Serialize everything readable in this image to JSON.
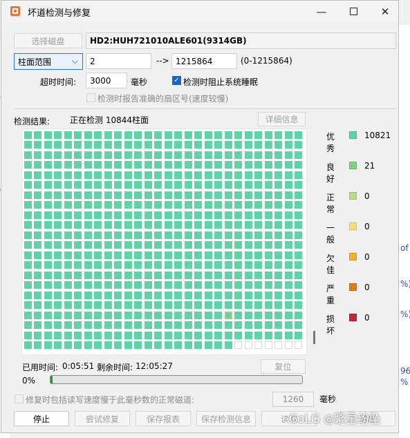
{
  "window": {
    "title": "坏道检测与修复"
  },
  "background": {
    "left_glyphs": [
      "F",
      "F:",
      "G",
      "C"
    ],
    "right_glyphs": [
      "of",
      "%)",
      "%)",
      "96",
      "%"
    ]
  },
  "disk": {
    "select_button": "选择磁盘",
    "name": "HD2:HUH721010ALE601(9314GB)"
  },
  "range": {
    "mode": "柱面范围",
    "start": "2",
    "arrow": "-->",
    "end": "1215864",
    "hint": "(0-1215864)"
  },
  "timeout": {
    "label": "超时时间:",
    "value": "3000",
    "unit": "毫秒"
  },
  "options": {
    "prevent_sleep": "检测时阻止系统睡眠",
    "report_sectors": "检测时报告准确的扇区号(速度较慢)"
  },
  "result": {
    "label": "检测结果:",
    "status": "正在检测 10844柱面",
    "detail_button": "详细信息"
  },
  "grid": {
    "cols": 28,
    "rows": 22,
    "done": 609,
    "marked": [
      [
        20,
        18
      ]
    ]
  },
  "legend": [
    {
      "name": "优秀",
      "count": "10821",
      "color": "#5fd3a7"
    },
    {
      "name": "良好",
      "count": "21",
      "color": "#7fd27f"
    },
    {
      "name": "正常",
      "count": "0",
      "color": "#bcd98a"
    },
    {
      "name": "一般",
      "count": "0",
      "color": "#f2de7c"
    },
    {
      "name": "欠佳",
      "count": "0",
      "color": "#f2b12b"
    },
    {
      "name": "严重",
      "count": "0",
      "color": "#e07d17"
    },
    {
      "name": "损坏",
      "count": "0",
      "color": "#c0273a"
    }
  ],
  "timing": {
    "elapsed_label": "已用时间:",
    "elapsed": "0:05:51",
    "remaining_label": "剩余时间:",
    "remaining": "12:05:27",
    "reset_button": "复位"
  },
  "progress": {
    "percent_text": "0%",
    "value": 0.009
  },
  "repair": {
    "option_label": "修复时包括读写速度慢于此毫秒数的正常磁道:",
    "threshold": "1260",
    "unit": "毫秒"
  },
  "buttons": {
    "stop": "停止",
    "try_repair": "尝试修复",
    "save_report": "保存报表",
    "save_info": "保存检测信息",
    "read": "读取",
    "close": "退出"
  },
  "watermark": "CoLG ◎繁星纷坠"
}
